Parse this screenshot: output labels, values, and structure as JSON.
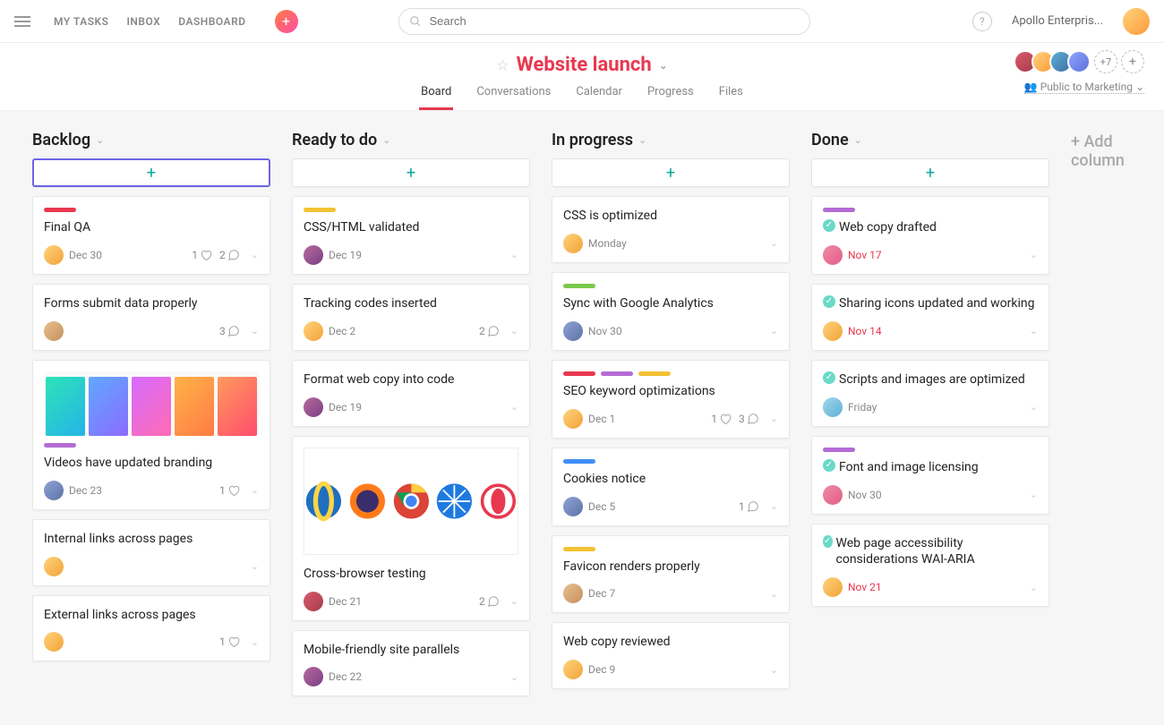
{
  "topnav": {
    "links": [
      "MY TASKS",
      "INBOX",
      "DASHBOARD"
    ],
    "search_placeholder": "Search",
    "workspace": "Apollo Enterpris...",
    "more_members": "+7"
  },
  "project": {
    "title": "Website launch",
    "tabs": [
      "Board",
      "Conversations",
      "Calendar",
      "Progress",
      "Files"
    ],
    "active_tab": "Board",
    "visibility": "Public to Marketing"
  },
  "add_column_label": "+ Add column",
  "columns": [
    {
      "title": "Backlog",
      "highlight_add": true,
      "cards": [
        {
          "tags": [
            "red"
          ],
          "title": "Final QA",
          "assignee": "a1",
          "date": "Dec 30",
          "likes": 1,
          "comments": 2
        },
        {
          "title": "Forms submit data properly",
          "assignee": "a3",
          "date": "",
          "comments": 3
        },
        {
          "image": "gradients",
          "tags": [
            "purple"
          ],
          "title": "Videos have updated branding",
          "assignee": "a4",
          "date": "Dec 23",
          "likes": 1
        },
        {
          "title": "Internal links across pages",
          "assignee": "a1",
          "date": ""
        },
        {
          "title": "External links across pages",
          "assignee": "a1",
          "date": "",
          "likes": 1
        }
      ]
    },
    {
      "title": "Ready to do",
      "cards": [
        {
          "tags": [
            "yellow"
          ],
          "title": "CSS/HTML validated",
          "assignee": "a2",
          "date": "Dec 19"
        },
        {
          "title": "Tracking codes inserted",
          "assignee": "a1",
          "date": "Dec 2",
          "comments": 2
        },
        {
          "title": "Format web copy into code",
          "assignee": "a2",
          "date": "Dec 19"
        },
        {
          "image": "browsers",
          "title": "Cross-browser testing",
          "assignee": "a6",
          "date": "Dec 21",
          "comments": 2
        },
        {
          "title": "Mobile-friendly site parallels",
          "assignee": "a2",
          "date": "Dec 22"
        }
      ]
    },
    {
      "title": "In progress",
      "cards": [
        {
          "title": "CSS is optimized",
          "assignee": "a1",
          "date": "Monday"
        },
        {
          "tags": [
            "green"
          ],
          "title": "Sync with Google Analytics",
          "assignee": "a4",
          "date": "Nov 30"
        },
        {
          "tags": [
            "red",
            "purple",
            "yellow"
          ],
          "title": "SEO keyword optimizations",
          "assignee": "a1",
          "date": "Dec 1",
          "likes": 1,
          "comments": 3
        },
        {
          "tags": [
            "blue"
          ],
          "title": "Cookies notice",
          "assignee": "a4",
          "date": "Dec 5",
          "comments": 1
        },
        {
          "tags": [
            "yellow"
          ],
          "title": "Favicon renders properly",
          "assignee": "a3",
          "date": "Dec 7"
        },
        {
          "title": "Web copy reviewed",
          "assignee": "a1",
          "date": "Dec 9"
        }
      ]
    },
    {
      "title": "Done",
      "cards": [
        {
          "tags": [
            "purple"
          ],
          "done": true,
          "title": "Web copy drafted",
          "assignee": "a5",
          "date": "Nov 17",
          "overdue": true
        },
        {
          "done": true,
          "title": "Sharing icons updated and working",
          "assignee": "a1",
          "date": "Nov 14",
          "overdue": true
        },
        {
          "done": true,
          "title": "Scripts and images are optimized",
          "assignee": "a7",
          "date": "Friday"
        },
        {
          "tags": [
            "purple"
          ],
          "done": true,
          "title": "Font and image licensing",
          "assignee": "a5",
          "date": "Nov 30"
        },
        {
          "done": true,
          "title": "Web page accessibility considerations WAI-ARIA",
          "assignee": "a1",
          "date": "Nov 21",
          "overdue": true
        }
      ]
    }
  ]
}
